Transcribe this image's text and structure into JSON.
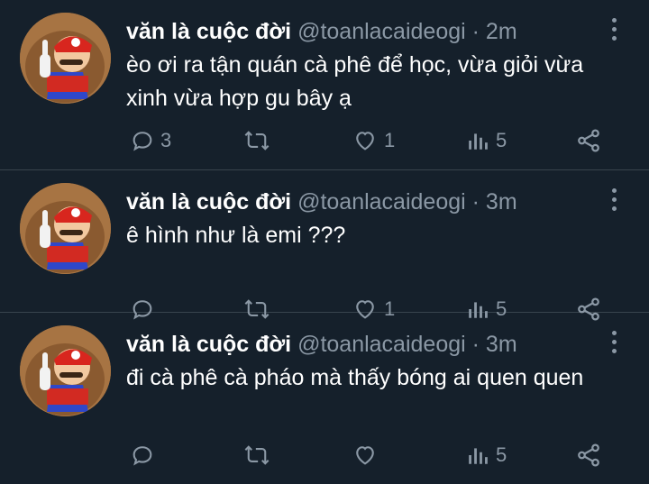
{
  "tweets": [
    {
      "author_name": "văn là cuộc đời",
      "handle": "@toanlacaideogi",
      "separator": "·",
      "time": "2m",
      "text": "èo ơi ra tận quán cà phê để học, vừa giỏi vừa xinh vừa hợp gu bây ạ",
      "replies": "3",
      "retweets": "",
      "likes": "1",
      "views": "5"
    },
    {
      "author_name": "văn là cuộc đời",
      "handle": "@toanlacaideogi",
      "separator": "·",
      "time": "3m",
      "text": "ê hình như là emi ???",
      "replies": "",
      "retweets": "",
      "likes": "1",
      "views": "5"
    },
    {
      "author_name": "văn là cuộc đời",
      "handle": "@toanlacaideogi",
      "separator": "·",
      "time": "3m",
      "text": "đi cà phê cà pháo mà thấy bóng ai quen quen",
      "replies": "",
      "retweets": "",
      "likes": "",
      "views": "5"
    }
  ],
  "icons": {
    "reply": "reply-icon",
    "retweet": "retweet-icon",
    "like": "heart-icon",
    "views": "views-icon",
    "share": "share-icon",
    "more": "more-icon"
  },
  "colors": {
    "background": "#15202b",
    "divider": "#38444d",
    "muted": "#8b98a5",
    "text": "#ffffff"
  }
}
